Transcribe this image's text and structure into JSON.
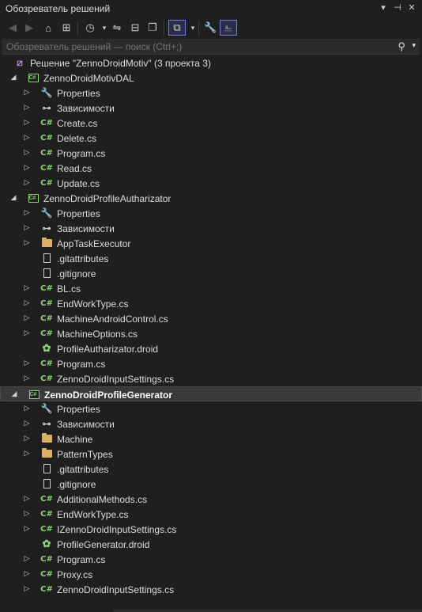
{
  "window": {
    "title": "Обозреватель решений",
    "buttons": [
      "▾",
      "⊣",
      "✕"
    ]
  },
  "search": {
    "placeholder": "Обозреватель решений — поиск (Ctrl+;)"
  },
  "tree": [
    {
      "label": "Решение \"ZennoDroidMotiv\"  (3 проекта 3)",
      "icon": "solution",
      "level": 0,
      "arrow": "none"
    },
    {
      "label": "ZennoDroidMotivDAL",
      "icon": "project",
      "level": 1,
      "arrow": "expanded"
    },
    {
      "label": "Properties",
      "icon": "properties",
      "level": 2,
      "arrow": "collapsed"
    },
    {
      "label": "Зависимости",
      "icon": "dependencies",
      "level": 2,
      "arrow": "collapsed"
    },
    {
      "label": "Create.cs",
      "icon": "csharp",
      "level": 2,
      "arrow": "collapsed"
    },
    {
      "label": "Delete.cs",
      "icon": "csharp",
      "level": 2,
      "arrow": "collapsed"
    },
    {
      "label": "Program.cs",
      "icon": "csharp",
      "level": 2,
      "arrow": "collapsed"
    },
    {
      "label": "Read.cs",
      "icon": "csharp",
      "level": 2,
      "arrow": "collapsed"
    },
    {
      "label": "Update.cs",
      "icon": "csharp",
      "level": 2,
      "arrow": "collapsed"
    },
    {
      "label": "ZennoDroidProfileAutharizator",
      "icon": "project",
      "level": 1,
      "arrow": "expanded"
    },
    {
      "label": "Properties",
      "icon": "properties",
      "level": 2,
      "arrow": "collapsed"
    },
    {
      "label": "Зависимости",
      "icon": "dependencies",
      "level": 2,
      "arrow": "collapsed"
    },
    {
      "label": "AppTaskExecutor",
      "icon": "folder",
      "level": 2,
      "arrow": "collapsed"
    },
    {
      "label": ".gitattributes",
      "icon": "file",
      "level": 2,
      "arrow": "none"
    },
    {
      "label": ".gitignore",
      "icon": "file",
      "level": 2,
      "arrow": "none"
    },
    {
      "label": "BL.cs",
      "icon": "csharp",
      "level": 2,
      "arrow": "collapsed"
    },
    {
      "label": "EndWorkType.cs",
      "icon": "csharp",
      "level": 2,
      "arrow": "collapsed"
    },
    {
      "label": "MachineAndroidControl.cs",
      "icon": "csharp",
      "level": 2,
      "arrow": "collapsed"
    },
    {
      "label": "MachineOptions.cs",
      "icon": "csharp",
      "level": 2,
      "arrow": "collapsed"
    },
    {
      "label": "ProfileAutharizator.droid",
      "icon": "droid",
      "level": 2,
      "arrow": "none"
    },
    {
      "label": "Program.cs",
      "icon": "csharp",
      "level": 2,
      "arrow": "collapsed"
    },
    {
      "label": "ZennoDroidInputSettings.cs",
      "icon": "csharp",
      "level": 2,
      "arrow": "collapsed"
    },
    {
      "label": "ZennoDroidProfileGenerator",
      "icon": "project",
      "level": 1,
      "arrow": "expanded",
      "selected": true,
      "bold": true
    },
    {
      "label": "Properties",
      "icon": "properties",
      "level": 2,
      "arrow": "collapsed"
    },
    {
      "label": "Зависимости",
      "icon": "dependencies",
      "level": 2,
      "arrow": "collapsed"
    },
    {
      "label": "Machine",
      "icon": "folder",
      "level": 2,
      "arrow": "collapsed"
    },
    {
      "label": "PatternTypes",
      "icon": "folder",
      "level": 2,
      "arrow": "collapsed"
    },
    {
      "label": ".gitattributes",
      "icon": "file",
      "level": 2,
      "arrow": "none"
    },
    {
      "label": ".gitignore",
      "icon": "file",
      "level": 2,
      "arrow": "none"
    },
    {
      "label": "AdditionalMethods.cs",
      "icon": "csharp",
      "level": 2,
      "arrow": "collapsed"
    },
    {
      "label": "EndWorkType.cs",
      "icon": "csharp",
      "level": 2,
      "arrow": "collapsed"
    },
    {
      "label": "IZennoDroidInputSettings.cs",
      "icon": "csharp",
      "level": 2,
      "arrow": "collapsed"
    },
    {
      "label": "ProfileGenerator.droid",
      "icon": "droid",
      "level": 2,
      "arrow": "none"
    },
    {
      "label": "Program.cs",
      "icon": "csharp",
      "level": 2,
      "arrow": "collapsed"
    },
    {
      "label": "Proxy.cs",
      "icon": "csharp",
      "level": 2,
      "arrow": "collapsed"
    },
    {
      "label": "ZennoDroidInputSettings.cs",
      "icon": "csharp",
      "level": 2,
      "arrow": "collapsed"
    }
  ]
}
